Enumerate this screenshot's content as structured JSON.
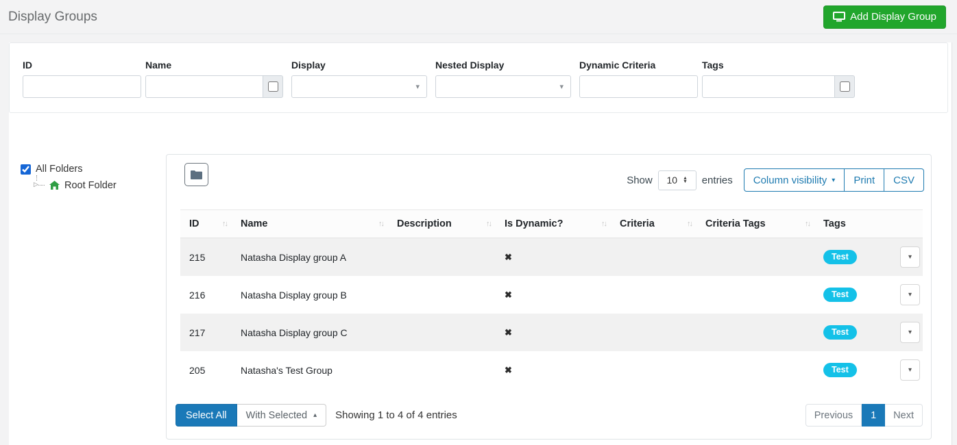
{
  "page": {
    "title": "Display Groups"
  },
  "header": {
    "add_button_label": "Add Display Group"
  },
  "filters": {
    "id_label": "ID",
    "name_label": "Name",
    "display_label": "Display",
    "nested_display_label": "Nested Display",
    "dynamic_criteria_label": "Dynamic Criteria",
    "tags_label": "Tags"
  },
  "sidebar": {
    "all_folders_label": "All Folders",
    "root_folder_label": "Root Folder"
  },
  "table_controls": {
    "show_label": "Show",
    "page_size": "10",
    "entries_label": "entries",
    "column_visibility_label": "Column visibility",
    "print_label": "Print",
    "csv_label": "CSV"
  },
  "table": {
    "columns": [
      {
        "label": "ID"
      },
      {
        "label": "Name"
      },
      {
        "label": "Description"
      },
      {
        "label": "Is Dynamic?"
      },
      {
        "label": "Criteria"
      },
      {
        "label": "Criteria Tags"
      },
      {
        "label": "Tags"
      }
    ],
    "rows": [
      {
        "id": "215",
        "name": "Natasha Display group A",
        "description": "",
        "is_dynamic": "✖",
        "criteria": "",
        "criteria_tags": "",
        "tag": "Test"
      },
      {
        "id": "216",
        "name": "Natasha Display group B",
        "description": "",
        "is_dynamic": "✖",
        "criteria": "",
        "criteria_tags": "",
        "tag": "Test"
      },
      {
        "id": "217",
        "name": "Natasha Display group C",
        "description": "",
        "is_dynamic": "✖",
        "criteria": "",
        "criteria_tags": "",
        "tag": "Test"
      },
      {
        "id": "205",
        "name": "Natasha's Test Group",
        "description": "",
        "is_dynamic": "✖",
        "criteria": "",
        "criteria_tags": "",
        "tag": "Test"
      }
    ]
  },
  "footer": {
    "select_all_label": "Select All",
    "with_selected_label": "With Selected",
    "showing_text": "Showing 1 to 4 of 4 entries",
    "pagination": {
      "previous": "Previous",
      "page": "1",
      "next": "Next"
    }
  },
  "icons": {
    "sort": "↑↓",
    "caret_down": "▾",
    "caret_up": "▴",
    "spinner_up": "▲",
    "spinner_down": "▼",
    "expander": "▷"
  },
  "colors": {
    "accent_green": "#21a62c",
    "accent_blue": "#1a79b8",
    "outline_blue": "#1d7ab0",
    "tag_cyan": "#14c1e8",
    "topbar_bg": "#f3f3f4",
    "stripe_gray": "#f1f1f1"
  }
}
